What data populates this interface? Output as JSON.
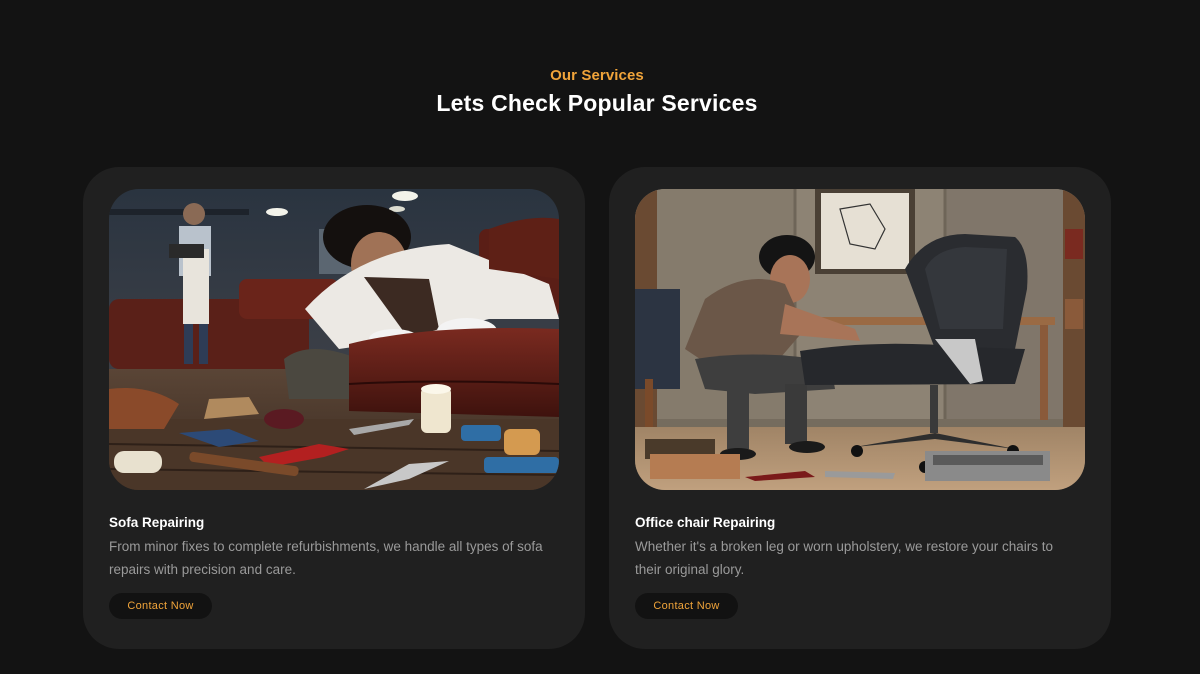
{
  "services": {
    "eyebrow": "Our Services",
    "heading": "Lets Check Popular Services",
    "cards": [
      {
        "title": "Sofa Repairing",
        "description": "From minor fixes to complete refurbishments, we handle all types of sofa repairs with precision and care.",
        "button_label": "Contact Now"
      },
      {
        "title": "Office chair Repairing",
        "description": "Whether it's a broken leg or worn upholstery, we restore your chairs to their original glory.",
        "button_label": "Contact Now"
      }
    ]
  },
  "colors": {
    "background": "#131313",
    "card": "#202020",
    "accent": "#f0a43a",
    "button_bg": "#121212",
    "text_muted": "#9a9a9a"
  }
}
